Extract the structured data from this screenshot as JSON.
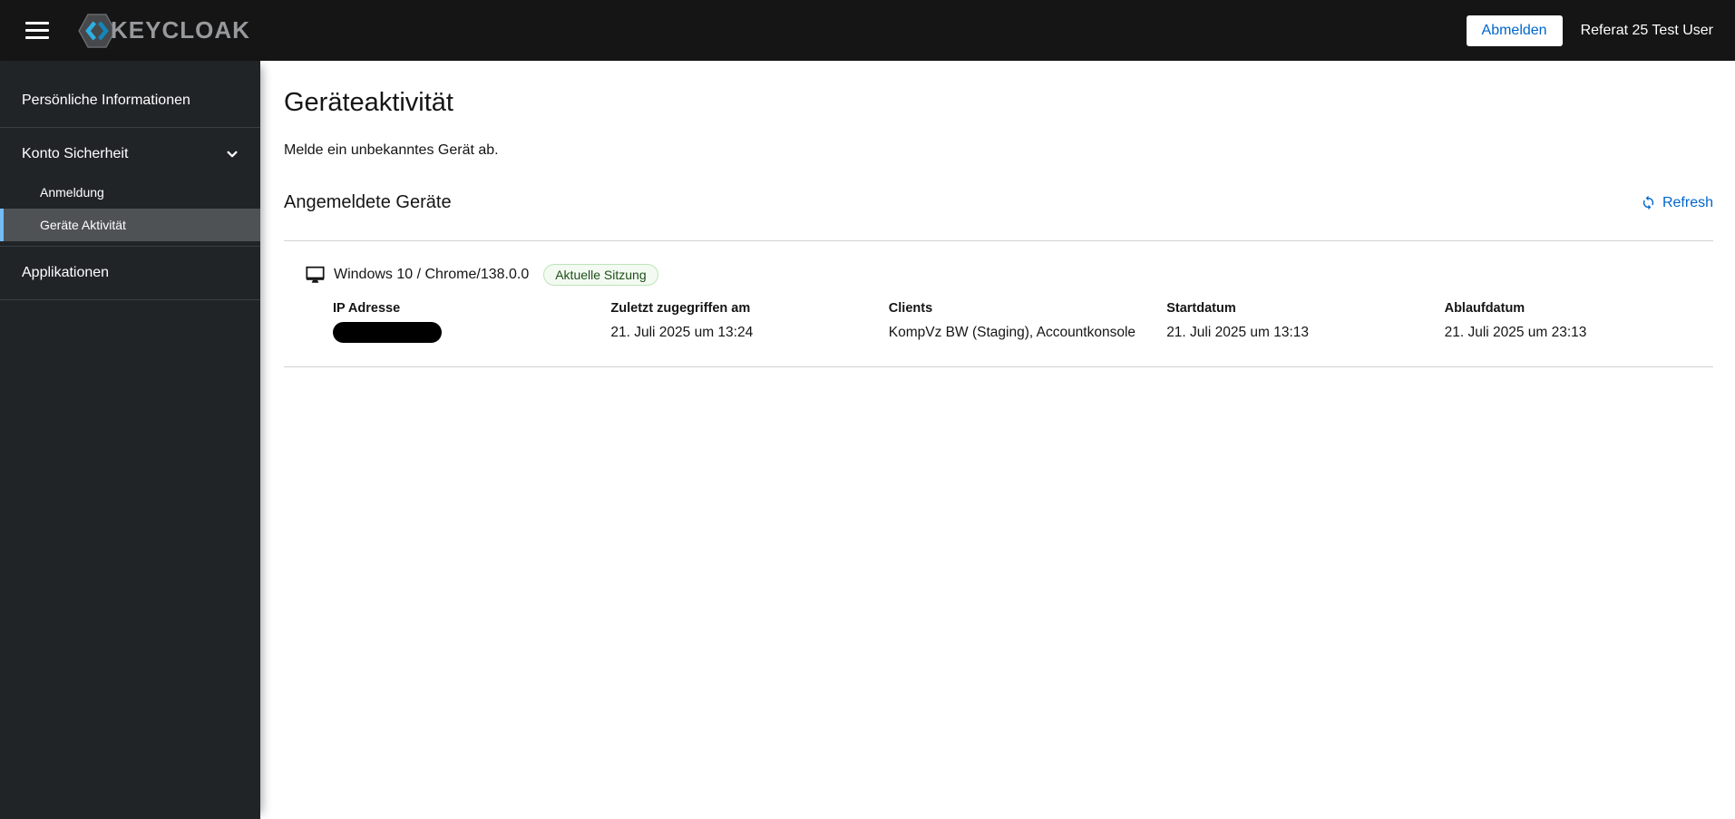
{
  "masthead": {
    "brand_text": "KEYCLOAK",
    "logout_label": "Abmelden",
    "user_name": "Referat 25 Test User"
  },
  "sidebar": {
    "items": [
      {
        "label": "Persönliche Informationen"
      },
      {
        "label": "Konto Sicherheit"
      },
      {
        "label": "Anmeldung"
      },
      {
        "label": "Geräte Aktivität"
      },
      {
        "label": "Applikationen"
      }
    ]
  },
  "main": {
    "title": "Geräteaktivität",
    "description": "Melde ein unbekanntes Gerät ab.",
    "section_title": "Angemeldete Geräte",
    "refresh_label": "Refresh",
    "device": {
      "name": "Windows 10 / Chrome/138.0.0",
      "badge": "Aktuelle Sitzung",
      "columns": [
        {
          "header": "IP Adresse",
          "value": "",
          "redacted": true
        },
        {
          "header": "Zuletzt zugegriffen am",
          "value": "21. Juli 2025 um 13:24"
        },
        {
          "header": "Clients",
          "value": "KompVz BW (Staging), Accountkonsole"
        },
        {
          "header": "Startdatum",
          "value": "21. Juli 2025 um 13:13"
        },
        {
          "header": "Ablaufdatum",
          "value": "21. Juli 2025 um 23:13"
        }
      ]
    }
  },
  "icons": {
    "hamburger": "menu-icon",
    "brand": "keycloak-logo",
    "nav_expand": "chevron-down-icon",
    "device": "desktop-monitor-icon",
    "refresh": "sync-icon"
  },
  "colors": {
    "masthead_bg": "#151515",
    "sidebar_bg": "#212427",
    "nav_active_bg": "#4f5255",
    "nav_active_border": "#73bcf7",
    "accent_blue": "#0066cc",
    "badge_bg": "#f3faf2",
    "badge_border": "#bde5b8",
    "badge_text": "#1e4f18",
    "divider": "#d2d2d2"
  }
}
